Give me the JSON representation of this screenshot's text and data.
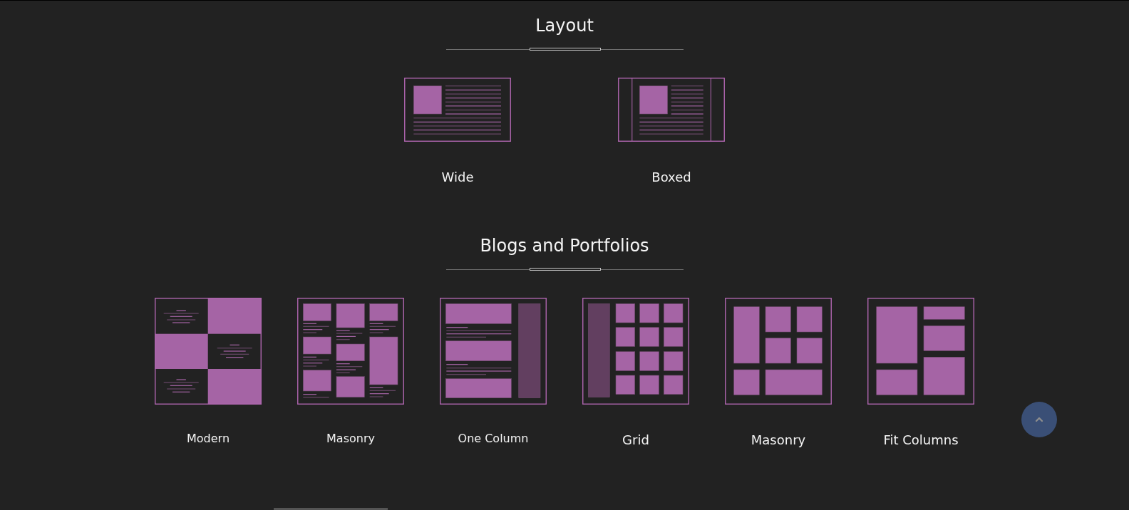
{
  "sections": [
    {
      "title": "Layout",
      "options": [
        {
          "label": "Wide",
          "kind": "wide"
        },
        {
          "label": "Boxed",
          "kind": "boxed"
        }
      ]
    },
    {
      "title": "Blogs and Portfolios",
      "options": [
        {
          "label": "Modern",
          "kind": "modern"
        },
        {
          "label": "Masonry",
          "kind": "masonry_posts"
        },
        {
          "label": "One Column",
          "kind": "one_column"
        },
        {
          "label": "Grid",
          "kind": "grid"
        },
        {
          "label": "Masonry",
          "kind": "masonry_tiles"
        },
        {
          "label": "Fit Columns",
          "kind": "fit_columns"
        }
      ]
    }
  ]
}
